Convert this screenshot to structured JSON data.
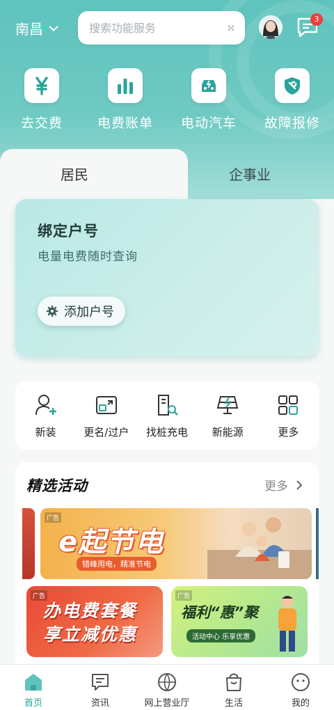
{
  "header": {
    "city": "南昌",
    "search_placeholder": "搜索功能服务",
    "message_badge": "3"
  },
  "quick_actions": [
    {
      "label": "去交费",
      "icon": "yuan-icon"
    },
    {
      "label": "电费账单",
      "icon": "bar-chart-icon"
    },
    {
      "label": "电动汽车",
      "icon": "ev-car-icon"
    },
    {
      "label": "故障报修",
      "icon": "repair-shield-icon"
    }
  ],
  "tabs": {
    "residential": "居民",
    "enterprise": "企事业"
  },
  "bind_card": {
    "title": "绑定户号",
    "subtitle": "电量电费随时查询",
    "button": "添加户号"
  },
  "services": [
    {
      "label": "新装",
      "icon": "user-add-icon"
    },
    {
      "label": "更名/过户",
      "icon": "transfer-icon"
    },
    {
      "label": "找桩充电",
      "icon": "charger-search-icon"
    },
    {
      "label": "新能源",
      "icon": "solar-panel-icon"
    },
    {
      "label": "更多",
      "icon": "grid-icon"
    }
  ],
  "activity": {
    "title": "精选活动",
    "more": "更多",
    "banner_main": {
      "ad": "广告",
      "title": "e起节电",
      "subtitle": "错峰用电，精准节电"
    },
    "banner_left": {
      "ad": "广告",
      "line1": "办电费套餐",
      "line2": "享立减优惠"
    },
    "banner_right": {
      "ad": "广告",
      "title": "福利“惠”聚",
      "tag": "活动中心 乐享优惠"
    }
  },
  "tabbar": [
    {
      "label": "首页",
      "icon": "home-icon",
      "active": true
    },
    {
      "label": "资讯",
      "icon": "news-icon",
      "active": false
    },
    {
      "label": "网上营业厅",
      "icon": "globe-icon",
      "active": false
    },
    {
      "label": "生活",
      "icon": "shopping-bag-icon",
      "active": false
    },
    {
      "label": "我的",
      "icon": "smile-face-icon",
      "active": false
    }
  ],
  "colors": {
    "brand": "#5fc3bd",
    "accent": "#2aa39b",
    "badge": "#e8413c"
  }
}
